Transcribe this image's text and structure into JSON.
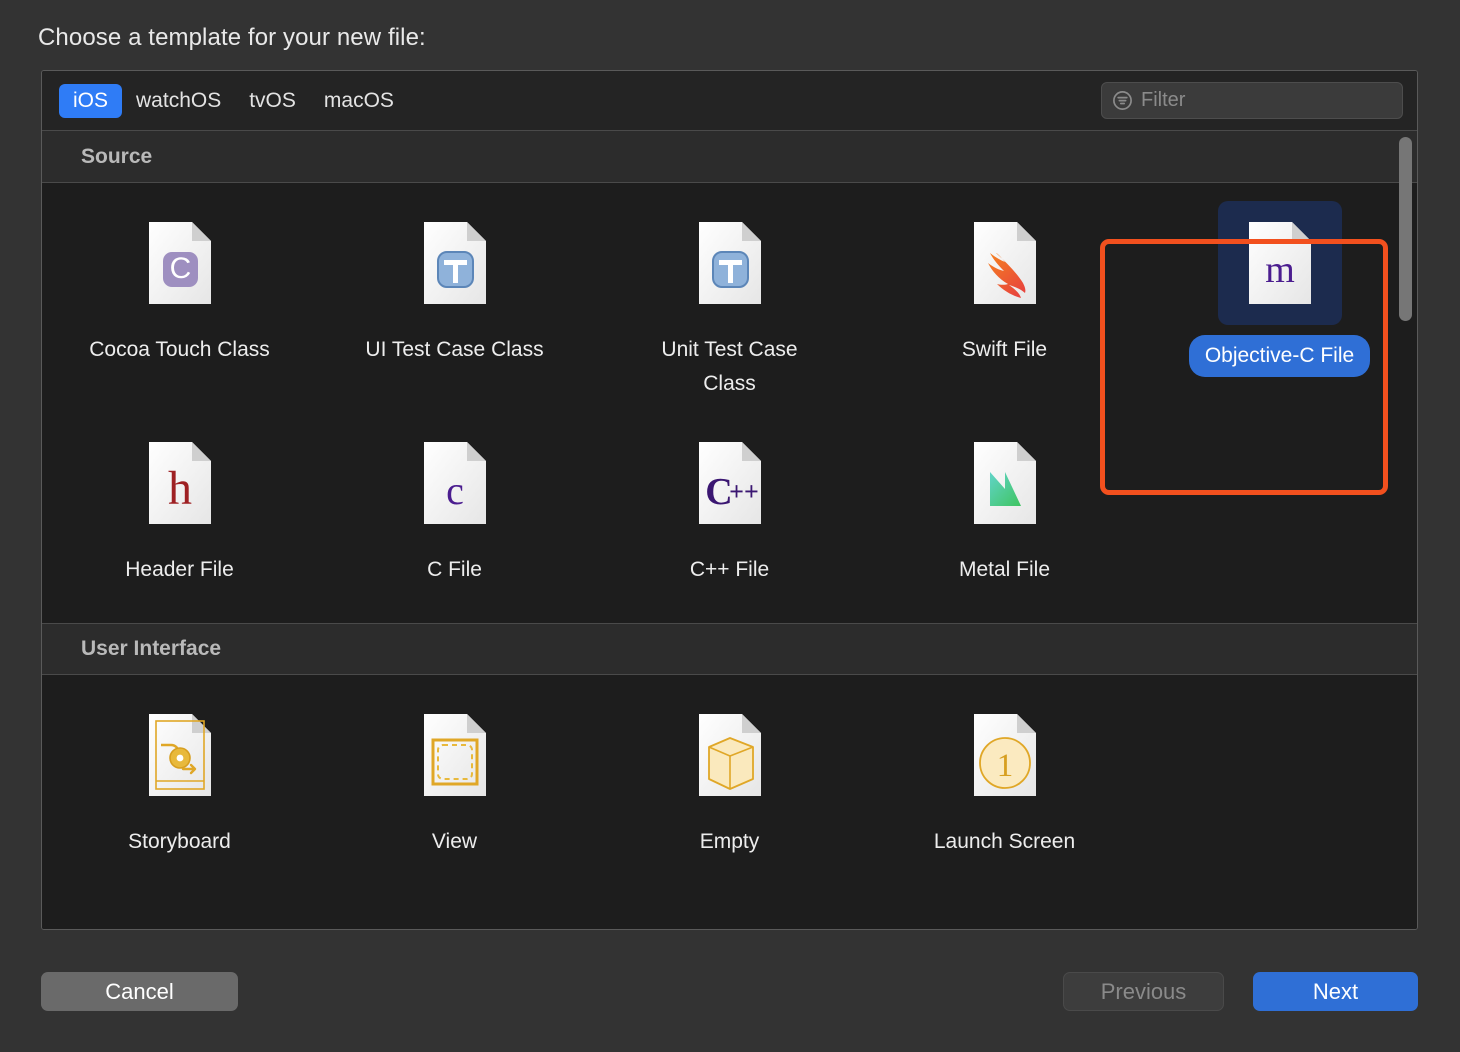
{
  "dialog": {
    "title": "Choose a template for your new file:"
  },
  "toolbar": {
    "platforms": [
      {
        "label": "iOS",
        "active": true
      },
      {
        "label": "watchOS",
        "active": false
      },
      {
        "label": "tvOS",
        "active": false
      },
      {
        "label": "macOS",
        "active": false
      }
    ],
    "filter": {
      "icon": "filter-icon",
      "value": "",
      "placeholder": "Filter"
    }
  },
  "sections": [
    {
      "header": "Source",
      "items": [
        {
          "label": "Cocoa Touch Class",
          "icon": "cocoa-touch-class-icon",
          "selected": false
        },
        {
          "label": "UI Test Case Class",
          "icon": "ui-test-case-class-icon",
          "selected": false
        },
        {
          "label": "Unit Test Case Class",
          "icon": "unit-test-case-class-icon",
          "selected": false
        },
        {
          "label": "Swift File",
          "icon": "swift-file-icon",
          "selected": false
        },
        {
          "label": "Objective-C File",
          "icon": "objective-c-file-icon",
          "selected": true
        },
        {
          "label": "Header File",
          "icon": "header-file-icon",
          "selected": false
        },
        {
          "label": "C File",
          "icon": "c-file-icon",
          "selected": false
        },
        {
          "label": "C++ File",
          "icon": "cpp-file-icon",
          "selected": false
        },
        {
          "label": "Metal File",
          "icon": "metal-file-icon",
          "selected": false
        }
      ]
    },
    {
      "header": "User Interface",
      "items": [
        {
          "label": "Storyboard",
          "icon": "storyboard-icon",
          "selected": false
        },
        {
          "label": "View",
          "icon": "view-icon",
          "selected": false
        },
        {
          "label": "Empty",
          "icon": "empty-icon",
          "selected": false
        },
        {
          "label": "Launch Screen",
          "icon": "launch-screen-icon",
          "selected": false
        }
      ]
    }
  ],
  "footer": {
    "cancel": "Cancel",
    "previous": "Previous",
    "next": "Next"
  },
  "colors": {
    "accent_blue": "#2f7cf6",
    "selection_highlight": "#f2501e",
    "selection_tile_bg": "#1c2b4e",
    "panel_bg": "#1d1d1d",
    "dialog_bg": "#333333"
  }
}
